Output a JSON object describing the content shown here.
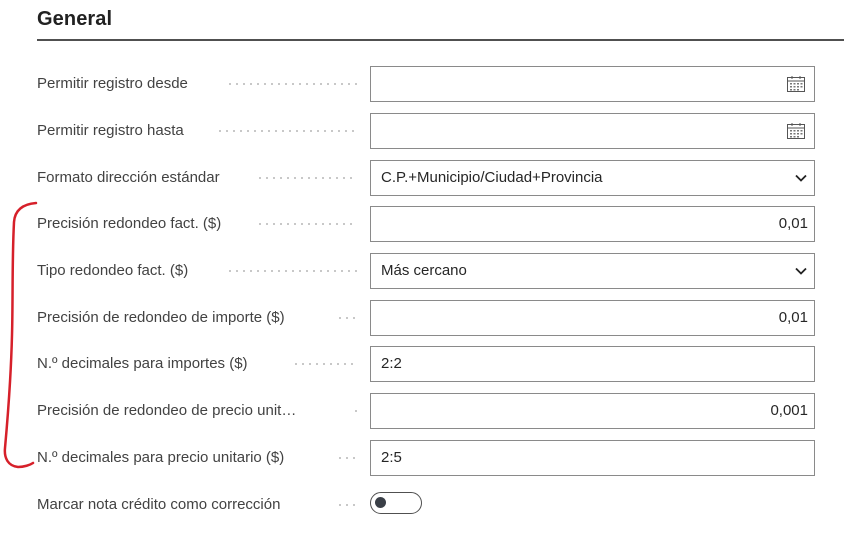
{
  "section": {
    "title": "General"
  },
  "fields": [
    {
      "label": "Permitir registro desde",
      "value": "",
      "control": "date"
    },
    {
      "label": "Permitir registro hasta",
      "value": "",
      "control": "date"
    },
    {
      "label": "Formato dirección estándar",
      "value": "C.P.+Municipio/Ciudad+Provincia",
      "control": "select"
    },
    {
      "label": "Precisión redondeo fact. ($)",
      "value": "0,01",
      "control": "number"
    },
    {
      "label": "Tipo redondeo fact. ($)",
      "value": "Más cercano",
      "control": "select"
    },
    {
      "label": "Precisión de redondeo de importe ($)",
      "value": "0,01",
      "control": "number"
    },
    {
      "label": "N.º decimales para importes ($)",
      "value": "2:2",
      "control": "text"
    },
    {
      "label": "Precisión de redondeo de precio unit…",
      "value": "0,001",
      "control": "number"
    },
    {
      "label": "N.º decimales para precio unitario ($)",
      "value": "2:5",
      "control": "text"
    },
    {
      "label": "Marcar nota crédito como corrección",
      "value": "off",
      "control": "toggle"
    }
  ],
  "colors": {
    "annotation": "#d6202a",
    "rule": "#505050",
    "border": "#8a8a8a"
  },
  "icons": {
    "date": "calendar-icon",
    "select": "chevron-down-icon"
  }
}
